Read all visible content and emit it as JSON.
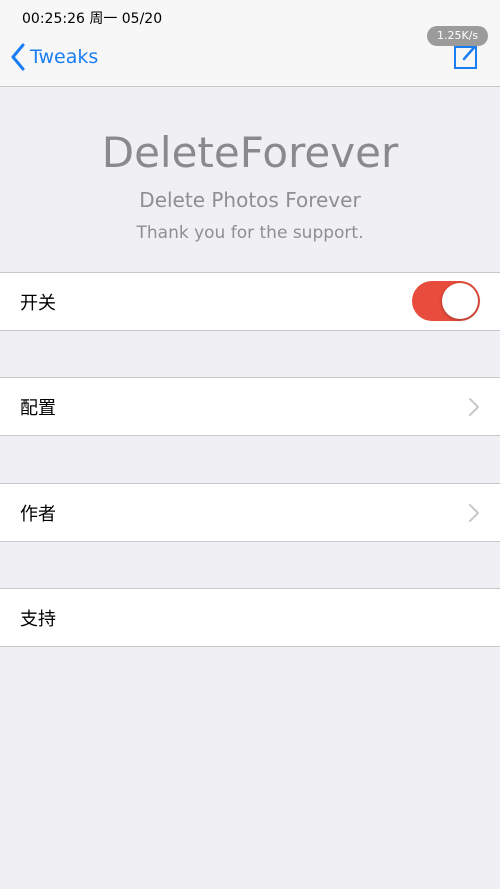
{
  "status": {
    "time": "00:25:26 周一 05/20",
    "speed": "1.25K/s"
  },
  "nav": {
    "back_label": "Tweaks",
    "accent": "#1a7ef2"
  },
  "header": {
    "title": "DeleteForever",
    "subtitle": "Delete Photos Forever",
    "thanks": "Thank you for the support."
  },
  "cells": [
    {
      "label": "开关",
      "toggle_on": true,
      "toggle_color": "#e74c3c"
    },
    {
      "label": "配置"
    },
    {
      "label": "作者"
    },
    {
      "label": "支持"
    }
  ]
}
